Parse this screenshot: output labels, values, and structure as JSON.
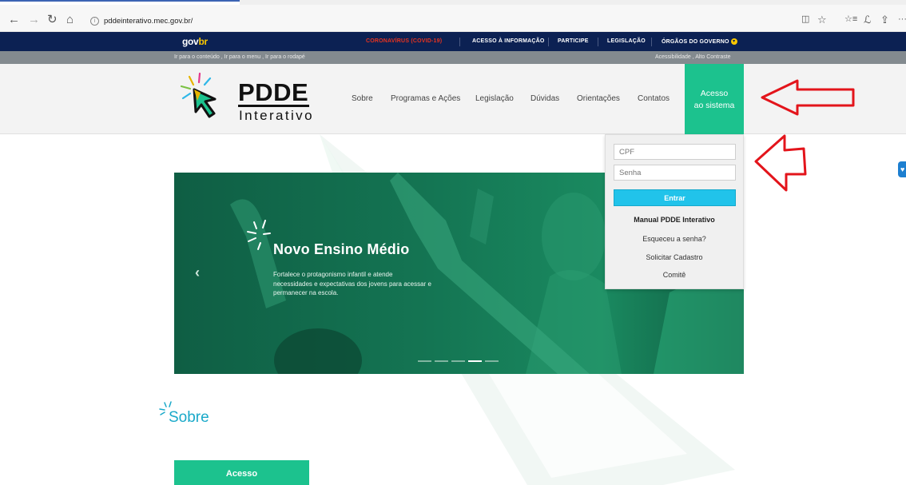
{
  "browser": {
    "back": "←",
    "forward": "→",
    "refresh": "↻",
    "home": "⌂",
    "url": "pddeinterativo.mec.gov.br/",
    "info_icon": "i",
    "right_icons": [
      "◫",
      "☆",
      "☆≡",
      "ℒ",
      "⇪",
      "···"
    ]
  },
  "gov_bar": {
    "logo_gov": "gov",
    "logo_br": "br",
    "links": {
      "covid": "CORONAVÍRUS (COVID-19)",
      "acesso_info": "ACESSO À INFORMAÇÃO",
      "participe": "PARTICIPE",
      "legislacao": "LEGISLAÇÃO",
      "orgaos": "ÓRGÃOS DO GOVERNO"
    }
  },
  "acc_bar": {
    "left": "Ir para o conteúdo , Ir para o menu , Ir para o rodapé",
    "right": "Acessibilidade , Alto Contraste"
  },
  "header": {
    "logo_title": "PDDE",
    "logo_sub": "Interativo",
    "menu": {
      "sobre": "Sobre",
      "programas": "Programas e Ações",
      "legislacao": "Legislação",
      "duvidas": "Dúvidas",
      "orientacoes": "Orientações",
      "contatos": "Contatos"
    },
    "acesso_line1": "Acesso",
    "acesso_line2": "ao sistema"
  },
  "hero": {
    "prev": "‹",
    "title": "Novo Ensino Médio",
    "text": "Fortalece o protagonismo infantil e atende necessidades e expectativas dos jovens para acessar e permanecer na escola.",
    "slide_count": 5,
    "active_slide": 4
  },
  "login": {
    "cpf_placeholder": "CPF",
    "senha_placeholder": "Senha",
    "entrar": "Entrar",
    "manual": "Manual PDDE Interativo",
    "esqueceu": "Esqueceu a senha?",
    "solicitar": "Solicitar Cadastro",
    "comite": "Comitê"
  },
  "sobre": {
    "title": "Sobre",
    "acesso_button": "Acesso"
  },
  "colors": {
    "gov_blue": "#0c2153",
    "brand_green": "#1cc28e",
    "entrar_cyan": "#21c3ea",
    "covid_red": "#e8331f",
    "annotation_red": "#e3141b"
  }
}
